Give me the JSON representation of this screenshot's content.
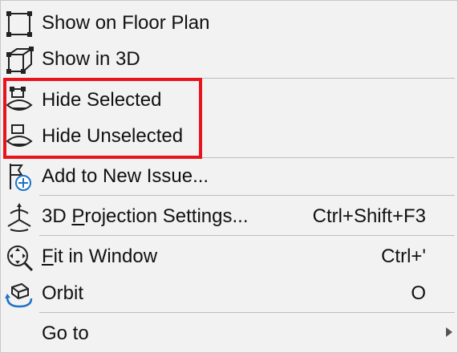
{
  "menu": {
    "items": [
      {
        "id": "show-floor-plan",
        "label": "Show on Floor Plan",
        "icon": "floor-plan-icon",
        "shortcut": ""
      },
      {
        "id": "show-3d",
        "label": "Show in 3D",
        "icon": "cube-3d-icon",
        "shortcut": ""
      },
      {
        "id": "hide-selected",
        "label": "Hide Selected",
        "icon": "hide-selected-icon",
        "shortcut": ""
      },
      {
        "id": "hide-unselected",
        "label": "Hide Unselected",
        "icon": "hide-unselected-icon",
        "shortcut": ""
      },
      {
        "id": "add-issue",
        "label": "Add to New Issue...",
        "icon": "flag-add-icon",
        "shortcut": ""
      },
      {
        "id": "projection",
        "label_before": "3D ",
        "label_mnemonic": "P",
        "label_after": "rojection Settings...",
        "icon": "projection-icon",
        "shortcut": "Ctrl+Shift+F3"
      },
      {
        "id": "fit-window",
        "label_before": "",
        "label_mnemonic": "F",
        "label_after": "it in Window",
        "icon": "fit-window-icon",
        "shortcut": "Ctrl+'"
      },
      {
        "id": "orbit",
        "label": "Orbit",
        "icon": "orbit-icon",
        "shortcut": "O"
      },
      {
        "id": "go-to",
        "label": "Go to",
        "icon": "",
        "shortcut": "",
        "has_submenu": true
      }
    ]
  },
  "colors": {
    "background": "#f2f2f2",
    "highlight_box": "#e8141c",
    "icon_blue": "#1e73c8"
  }
}
